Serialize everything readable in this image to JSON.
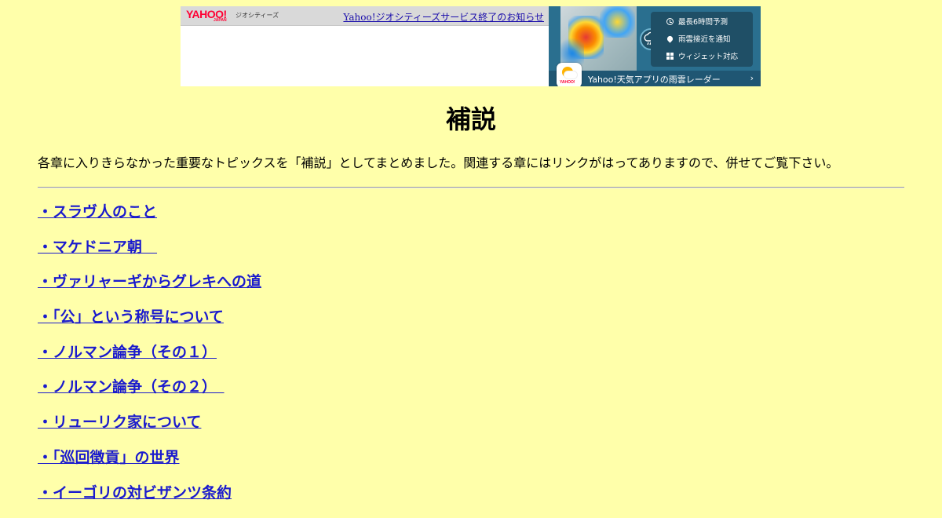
{
  "banner": {
    "yahoo_logo": "YAHOO!",
    "yahoo_logo_sub": "JAPAN",
    "geocities_label": "ジオシティーズ",
    "end_notice_link": "Yahoo!ジオシティーズサービス終了のお知らせ",
    "weather_ad": {
      "features": [
        {
          "icon": "clock-icon",
          "label": "最長6時間予測"
        },
        {
          "icon": "map-pin-icon",
          "label": "雨雲接近を通知"
        },
        {
          "icon": "widget-icon",
          "label": "ウィジェット対応"
        }
      ],
      "cta": "Yahoo!天気アプリの雨雲レーダー",
      "app_brand": "YAHOO!"
    }
  },
  "page": {
    "title": "補説",
    "intro": "各章に入りきらなかった重要なトピックスを「補説」としてまとめました。関連する章にはリンクがはってありますので、併せてご覧下さい。"
  },
  "topics": [
    "・スラヴ人のこと",
    "・マケドニア朝　",
    "・ヴァリャーギからグレキへの道",
    "・「公」という称号について",
    "・ノルマン論争（その１）",
    "・ノルマン論争（その２）　",
    "・リューリク家について",
    "・「巡回徴貢」の世界",
    "・イーゴリの対ビザンツ条約"
  ],
  "colors": {
    "background": "#ffffaa",
    "link": "#1a1acd",
    "ad_blue": "#2a6f8f"
  }
}
